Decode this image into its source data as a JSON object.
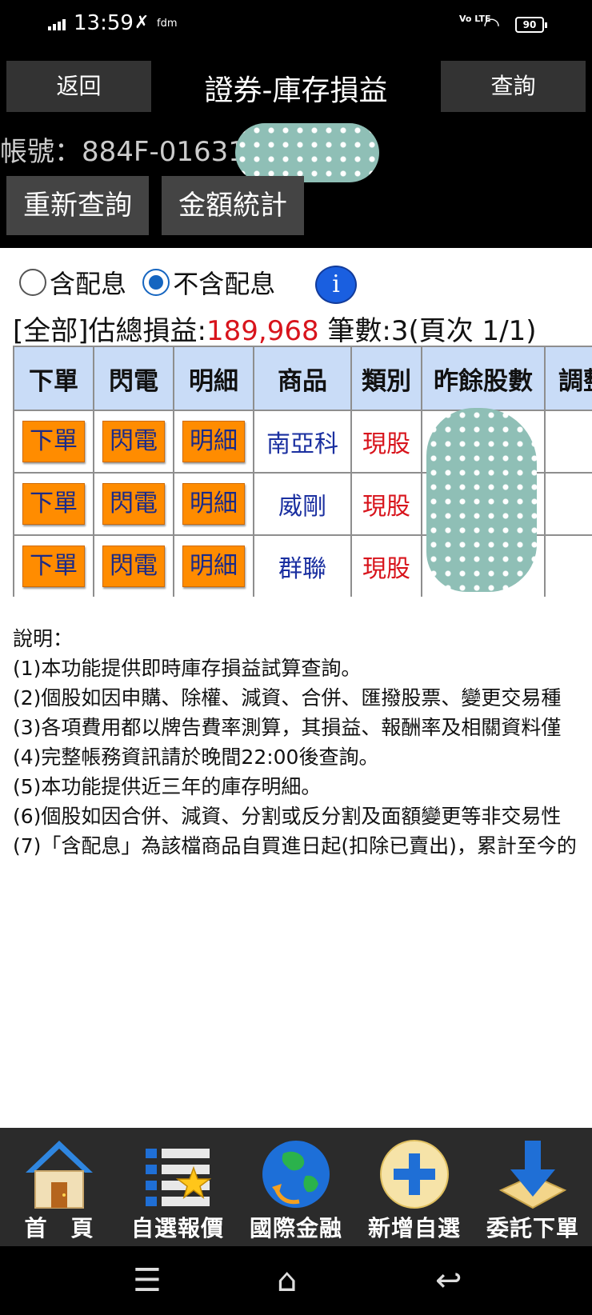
{
  "status_bar": {
    "time": "13:59",
    "carrier_tag": "fdm",
    "volte": "Vo LTE",
    "battery": "90"
  },
  "header": {
    "back_label": "返回",
    "title": "證券-庫存損益",
    "query_label": "查詢",
    "account_label": "帳號：884F-01631",
    "requery_label": "重新查詢",
    "sum_label": "金額統計"
  },
  "filters": {
    "with_dividend": "含配息",
    "without_dividend": "不含配息",
    "selected": "不含配息"
  },
  "summary": {
    "prefix": "[全部]估總損益:",
    "total": "189,968",
    "suffix": " 筆數:3(頁次 1/1)"
  },
  "table": {
    "headers": [
      "下單",
      "閃電",
      "明細",
      "商品",
      "類別",
      "昨餘股數",
      "調整"
    ],
    "rows": [
      {
        "order": "下單",
        "flash": "閃電",
        "detail": "明細",
        "product": "南亞科",
        "type": "現股"
      },
      {
        "order": "下單",
        "flash": "閃電",
        "detail": "明細",
        "product": "威剛",
        "type": "現股"
      },
      {
        "order": "下單",
        "flash": "閃電",
        "detail": "明細",
        "product": "群聯",
        "type": "現股"
      }
    ]
  },
  "notes": {
    "title": "說明：",
    "items": [
      "(1)本功能提供即時庫存損益試算查詢。",
      "(2)個股如因申購、除權、減資、合併、匯撥股票、變更交易種",
      "(3)各項費用都以牌告費率測算，其損益、報酬率及相關資料僅",
      "(4)完整帳務資訊請於晚間22:00後查詢。",
      "(5)本功能提供近三年的庫存明細。",
      "(6)個股如因合併、減資、分割或反分割及面額變更等非交易性",
      "(7)「含配息」為該檔商品自買進日起(扣除已賣出)，累計至今的"
    ]
  },
  "tabbar": [
    {
      "label": "首　頁",
      "icon": "home-icon"
    },
    {
      "label": "自選報價",
      "icon": "watchlist-star-icon"
    },
    {
      "label": "國際金融",
      "icon": "globe-icon"
    },
    {
      "label": "新增自選",
      "icon": "add-plus-icon"
    },
    {
      "label": "委託下單",
      "icon": "download-arrow-icon"
    }
  ],
  "colors": {
    "accent_red": "#d8141c",
    "order_button": "#ff8c00",
    "table_header": "#c9dcf7",
    "product_blue": "#1a2fa0"
  }
}
